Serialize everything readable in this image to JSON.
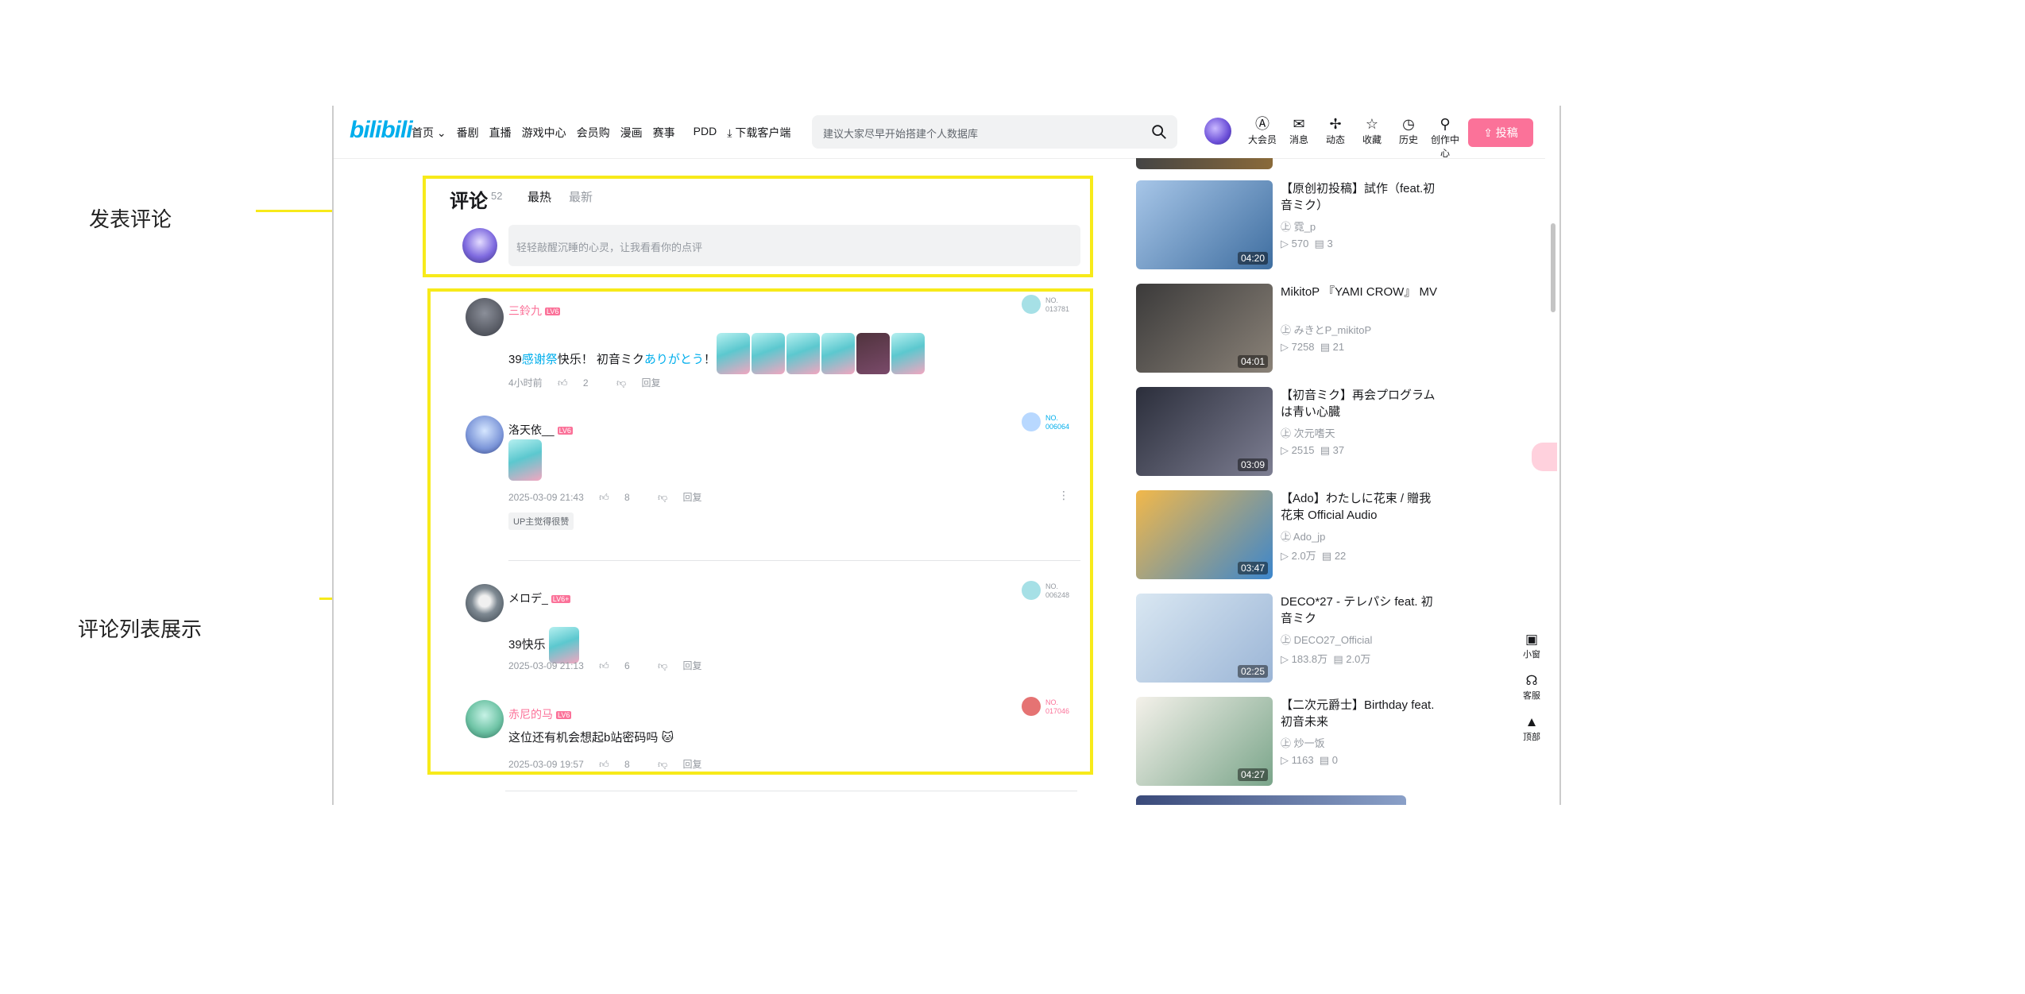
{
  "annotations": {
    "post_comment": "发表评论",
    "comment_list": "评论列表展示"
  },
  "header": {
    "logo": "bilibili",
    "nav": [
      "首页 ⌄",
      "番剧",
      "直播",
      "游戏中心",
      "会员购",
      "漫画",
      "赛事",
      "PDD",
      "下载客户端"
    ],
    "search_placeholder": "建议大家尽早开始搭建个人数据库",
    "icons": [
      {
        "glyph": "Ⓐ",
        "label": "大会员",
        "icon": "vip-icon"
      },
      {
        "glyph": "✉",
        "label": "消息",
        "icon": "message-icon"
      },
      {
        "glyph": "✢",
        "label": "动态",
        "icon": "dynamic-icon"
      },
      {
        "glyph": "☆",
        "label": "收藏",
        "icon": "star-icon"
      },
      {
        "glyph": "◷",
        "label": "历史",
        "icon": "clock-icon"
      },
      {
        "glyph": "⚲",
        "label": "创作中心",
        "icon": "creator-icon"
      }
    ],
    "upload_label": "⇪ 投稿"
  },
  "comment_box": {
    "title": "评论",
    "count": "52",
    "sort_hot": "最热",
    "sort_new": "最新",
    "placeholder": "轻轻敲醒沉睡的心灵，让我看看你的点评"
  },
  "comments": [
    {
      "user": "三鈴九",
      "level": "LV6",
      "text_a": "39",
      "text_b": "感谢祭",
      "text_c": "快乐！ 初音ミク",
      "text_d": "ありがとう",
      "text_e": "！",
      "time": "4小时前",
      "likes": "2",
      "reply": "回复",
      "fan": "NO.\n013781"
    },
    {
      "user": "洛天依__",
      "level": "LV6",
      "time": "2025-03-09 21:43",
      "likes": "8",
      "reply": "回复",
      "badge": "UP主觉得很赞",
      "fan": "NO.\n006064"
    },
    {
      "user": "メロデ_",
      "level": "LV6+",
      "text": "39快乐",
      "time": "2025-03-09 21:13",
      "likes": "6",
      "reply": "回复",
      "fan": "NO.\n006248"
    },
    {
      "user": "赤尼的马",
      "level": "LV6",
      "text": "这位还有机会想起b站密码吗",
      "time": "2025-03-09 19:57",
      "likes": "8",
      "reply": "回复",
      "fan": "NO.\n017046"
    }
  ],
  "videos": [
    {
      "title": "【原创初投稿】試作（feat.初音ミク）",
      "up": "霓_p",
      "plays": "570",
      "danmaku": "3",
      "duration": "04:20",
      "colors": [
        "#a7c6e8",
        "#3f6ea0"
      ]
    },
    {
      "title": "MikitoP 『YAMI CROW』 MV",
      "up": "みきとP_mikitoP",
      "plays": "7258",
      "danmaku": "21",
      "duration": "04:01",
      "colors": [
        "#3b3a3a",
        "#8a8278"
      ]
    },
    {
      "title": "【初音ミク】再会プログラムは青い心臓",
      "up": "次元嗜天",
      "plays": "2515",
      "danmaku": "37",
      "duration": "03:09",
      "colors": [
        "#2b2e3b",
        "#7d7e92"
      ]
    },
    {
      "title": "【Ado】わたしに花束 / 贈我花束 Official Audio",
      "up": "Ado_jp",
      "plays": "2.0万",
      "danmaku": "22",
      "duration": "03:47",
      "colors": [
        "#f2b84a",
        "#3c86cc"
      ]
    },
    {
      "title": "DECO*27 - テレパシ feat. 初音ミク",
      "up": "DECO27_Official",
      "plays": "183.8万",
      "danmaku": "2.0万",
      "duration": "02:25",
      "colors": [
        "#d9e7f2",
        "#9bb5d6"
      ]
    },
    {
      "title": "【二次元爵士】Birthday feat. 初音未来",
      "up": "炒一饭",
      "plays": "1163",
      "danmaku": "0",
      "duration": "04:27",
      "colors": [
        "#f4f1ea",
        "#7aa58a"
      ]
    }
  ],
  "side_tools": [
    {
      "glyph": "▣",
      "label": "小窗",
      "icon": "mini-window-icon"
    },
    {
      "glyph": "☊",
      "label": "客服",
      "icon": "headset-icon"
    },
    {
      "glyph": "▲",
      "label": "顶部",
      "icon": "back-to-top-icon"
    }
  ],
  "accent_color": "#fb7299",
  "link_color": "#00aeec",
  "annotation_color": "#f7ea1a"
}
